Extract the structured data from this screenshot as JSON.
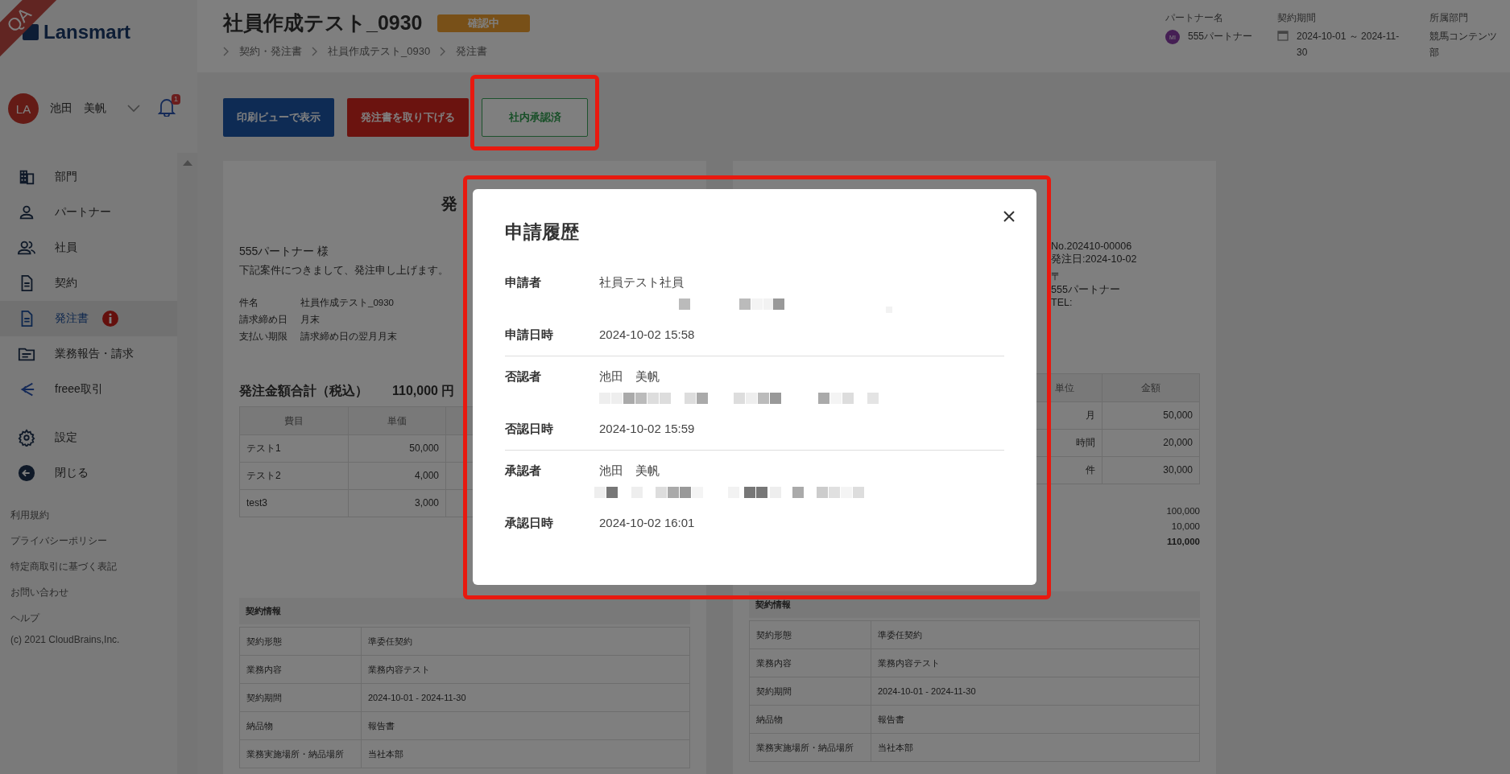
{
  "sidebar": {
    "ribbon": "QA",
    "logo": "Lansmart",
    "user": {
      "avatar": "LA",
      "name": "池田　美帆",
      "notifications": "1"
    },
    "nav": [
      {
        "label": "部門",
        "kind": "building",
        "selected": false,
        "alert": false
      },
      {
        "label": "パートナー",
        "kind": "person",
        "selected": false,
        "alert": false
      },
      {
        "label": "社員",
        "kind": "people",
        "selected": false,
        "alert": false
      },
      {
        "label": "契約",
        "kind": "document",
        "selected": false,
        "alert": false
      },
      {
        "label": "発注書",
        "kind": "document",
        "selected": true,
        "alert": true
      },
      {
        "label": "業務報告・請求",
        "kind": "folder",
        "selected": false,
        "alert": false
      },
      {
        "label": "freee取引",
        "kind": "wing",
        "selected": false,
        "alert": false
      }
    ],
    "nav_bottom": [
      {
        "label": "設定",
        "kind": "gear",
        "selected": false
      },
      {
        "label": "閉じる",
        "kind": "back",
        "selected": false
      }
    ],
    "links": [
      "利用規約",
      "プライバシーポリシー",
      "特定商取引に基づく表記",
      "お問い合わせ",
      "ヘルプ"
    ],
    "copyright": "(c) 2021 CloudBrains,Inc."
  },
  "header": {
    "title": "社員作成テスト_0930",
    "status": "確認中",
    "breadcrumb": [
      "契約・発注書",
      "社員作成テスト_0930",
      "発注書"
    ],
    "info": [
      {
        "label": "パートナー名",
        "kind": "avatar",
        "avatar": "MI",
        "value": "555パートナー"
      },
      {
        "label": "契約期間",
        "kind": "calendar",
        "value": "2024-10-01 ～ 2024-11-30"
      },
      {
        "label": "所属部門",
        "kind": "text",
        "value": "競馬コンテンツ部"
      }
    ]
  },
  "actions": [
    {
      "label": "印刷ビューで表示",
      "kind": "primary",
      "highlighted": false
    },
    {
      "label": "発注書を取り下げる",
      "kind": "danger",
      "highlighted": false
    },
    {
      "label": "社内承認済",
      "kind": "approved",
      "highlighted": true
    }
  ],
  "order_left": {
    "title": "発",
    "recipient": "555パートナー 様",
    "intro": "下記案件につきまして、発注申し上げます。",
    "fields": [
      {
        "label": "件名",
        "value": "社員作成テスト_0930"
      },
      {
        "label": "請求締め日",
        "value": "月末"
      },
      {
        "label": "支払い期限",
        "value": "請求締め日の翌月月末"
      }
    ],
    "total_label": "発注金額合計（税込）",
    "total_value": "110,000 円",
    "items": {
      "columns": [
        "費目",
        "単価"
      ],
      "rows": [
        [
          "テスト1",
          "50,000"
        ],
        [
          "テスト2",
          "4,000"
        ],
        [
          "test3",
          "3,000"
        ]
      ]
    },
    "contract": {
      "heading": "契約情報",
      "rows": [
        [
          "契約形態",
          "準委任契約"
        ],
        [
          "業務内容",
          "業務内容テスト"
        ],
        [
          "契約期間",
          "2024-10-01 - 2024-11-30"
        ],
        [
          "納品物",
          "報告書"
        ],
        [
          "業務実施場所・納品場所",
          "当社本部"
        ]
      ]
    }
  },
  "order_right": {
    "info": [
      "No.202410-00006",
      "発注日:2024-10-02",
      "〒",
      "555パートナー",
      "TEL:"
    ],
    "items": {
      "columns": [
        "単位",
        "金額"
      ],
      "rows": [
        [
          "月",
          "50,000"
        ],
        [
          "時間",
          "20,000"
        ],
        [
          "件",
          "30,000"
        ]
      ]
    },
    "totals": [
      {
        "value": "100,000",
        "kind": "subtotal"
      },
      {
        "value": "10,000",
        "kind": "subtotal"
      },
      {
        "value": "110,000",
        "kind": "grand"
      }
    ],
    "contract": {
      "heading": "契約情報",
      "rows": [
        [
          "契約形態",
          "準委任契約"
        ],
        [
          "業務内容",
          "業務内容テスト"
        ],
        [
          "契約期間",
          "2024-10-01 - 2024-11-30"
        ],
        [
          "納品物",
          "報告書"
        ],
        [
          "業務実施場所・納品場所",
          "当社本部"
        ]
      ]
    }
  },
  "modal": {
    "title": "申請履歴",
    "highlighted": true,
    "entries": [
      {
        "person_label": "申請者",
        "person": "社員テスト社員",
        "redacted": true,
        "date_label": "申請日時",
        "date": "2024-10-02 15:58"
      },
      {
        "person_label": "否認者",
        "person": "池田　美帆",
        "redacted": true,
        "date_label": "否認日時",
        "date": "2024-10-02 15:59"
      },
      {
        "person_label": "承認者",
        "person": "池田　美帆",
        "redacted": true,
        "date_label": "承認日時",
        "date": "2024-10-02 16:01"
      }
    ]
  }
}
